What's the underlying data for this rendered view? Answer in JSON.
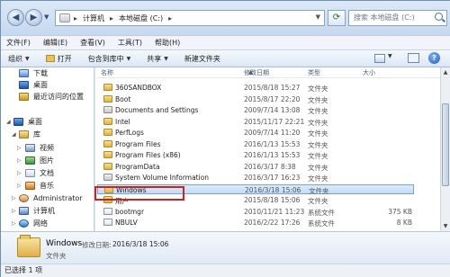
{
  "address": {
    "segments": [
      "计算机",
      "本地磁盘 (C:)"
    ],
    "search_placeholder": "搜索 本地磁盘 (C:)"
  },
  "menu": [
    "文件(F)",
    "编辑(E)",
    "查看(V)",
    "工具(T)",
    "帮助(H)"
  ],
  "commands": {
    "organize": "组织",
    "open": "打开",
    "include_in_library": "包含到库中",
    "share": "共享",
    "new_folder": "新建文件夹"
  },
  "nav": {
    "downloads": "下载",
    "desktop": "桌面",
    "recent": "最近访问的位置",
    "desktop_root": "桌面",
    "library": "库",
    "videos": "视频",
    "pictures": "图片",
    "documents": "文档",
    "music": "音乐",
    "administrator": "Administrator",
    "computer": "计算机",
    "network": "网络"
  },
  "columns": {
    "name": "名称",
    "date": "修改日期",
    "type": "类型",
    "size": "大小"
  },
  "files": [
    {
      "name": "360SANDBOX",
      "date": "2015/8/18 15:27",
      "type": "文件夹",
      "size": "",
      "icon": "folder-icon"
    },
    {
      "name": "Boot",
      "date": "2015/8/17 22:20",
      "type": "文件夹",
      "size": "",
      "icon": "folder-icon"
    },
    {
      "name": "Documents and Settings",
      "date": "2009/7/14 13:08",
      "type": "文件夹",
      "size": "",
      "icon": "system-folder-icon"
    },
    {
      "name": "Intel",
      "date": "2015/11/17 22:21",
      "type": "文件夹",
      "size": "",
      "icon": "folder-icon"
    },
    {
      "name": "PerfLogs",
      "date": "2009/7/14 11:20",
      "type": "文件夹",
      "size": "",
      "icon": "folder-icon"
    },
    {
      "name": "Program Files",
      "date": "2016/1/13 15:53",
      "type": "文件夹",
      "size": "",
      "icon": "folder-icon"
    },
    {
      "name": "Program Files (x86)",
      "date": "2016/1/13 15:53",
      "type": "文件夹",
      "size": "",
      "icon": "folder-icon"
    },
    {
      "name": "ProgramData",
      "date": "2016/3/17 8:38",
      "type": "文件夹",
      "size": "",
      "icon": "folder-icon"
    },
    {
      "name": "System Volume Information",
      "date": "2016/3/17 16:23",
      "type": "文件夹",
      "size": "",
      "icon": "system-folder-icon"
    },
    {
      "name": "Windows",
      "date": "2016/3/18 15:06",
      "type": "文件夹",
      "size": "",
      "icon": "folder-icon"
    },
    {
      "name": "用户",
      "date": "2015/8/18 15:06",
      "type": "文件夹",
      "size": "",
      "icon": "folder-icon"
    },
    {
      "name": "bootmgr",
      "date": "2010/11/21 11:23",
      "type": "系统文件",
      "size": "375 KB",
      "icon": "file-icon"
    },
    {
      "name": "NBULV",
      "date": "2016/2/22 17:26",
      "type": "系统文件",
      "size": "8 KB",
      "icon": "file-icon"
    }
  ],
  "details": {
    "name": "Windows",
    "modified_label": "修改日期:",
    "modified_date": "2016/3/18 15:06",
    "type": "文件夹"
  },
  "status": "已选择 1 项"
}
